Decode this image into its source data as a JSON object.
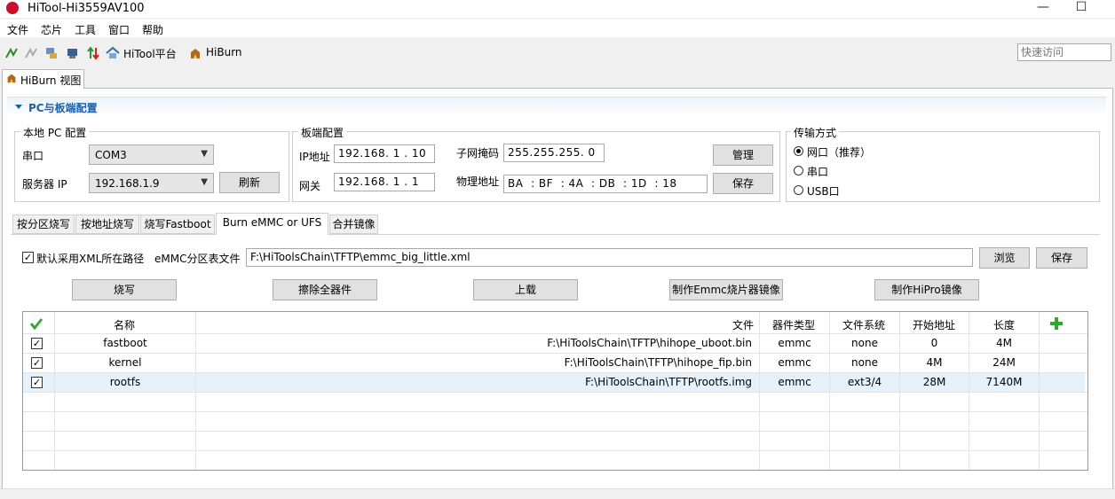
{
  "window": {
    "title": "HiTool-Hi3559AV100",
    "minimize": "—",
    "maximize": "☐"
  },
  "menu": [
    "文件",
    "芯片",
    "工具",
    "窗口",
    "帮助"
  ],
  "toolbar": {
    "hitool_label": "HiTool平台",
    "hiburn_label": "HiBurn",
    "quick_access_placeholder": "快速访问"
  },
  "view_tab": "HiBurn 视图",
  "section": {
    "title": "PC与板端配置"
  },
  "local_pc": {
    "group_title": "本地 PC 配置",
    "port_label": "串口",
    "port_value": "COM3",
    "server_ip_label": "服务器 IP",
    "server_ip_value": "192.168.1.9",
    "refresh_label": "刷新"
  },
  "board": {
    "group_title": "板端配置",
    "ip_label": "IP地址",
    "ip_value": "192.168. 1 . 10",
    "gateway_label": "网关",
    "gateway_value": "192.168. 1 . 1",
    "mask_label": "子网掩码",
    "mask_value": "255.255.255. 0",
    "mac_label": "物理地址",
    "mac_value": "BA  : BF  : 4A  : DB  : 1D  : 18",
    "manage_label": "管理",
    "save_label": "保存"
  },
  "transfer": {
    "group_title": "传输方式",
    "options": [
      "网口（推荐）",
      "串口",
      "USB口"
    ],
    "selected": "网口（推荐）"
  },
  "tabs": [
    "按分区烧写",
    "按地址烧写",
    "烧写Fastboot",
    "Burn eMMC or UFS",
    "合并镜像"
  ],
  "active_tab": "Burn eMMC or UFS",
  "emmc": {
    "default_xml_label": "默认采用XML所在路径",
    "default_xml_checked": true,
    "table_file_label": "eMMC分区表文件",
    "table_file_value": "F:\\HiToolsChain\\TFTP\\emmc_big_little.xml",
    "browse_label": "浏览",
    "save_label": "保存"
  },
  "actions": {
    "burn": "烧写",
    "erase": "擦除全器件",
    "upload": "上载",
    "make_emmc": "制作Emmc烧片器镜像",
    "make_hipro": "制作HiPro镜像"
  },
  "table": {
    "headers": {
      "name": "名称",
      "file": "文件",
      "device": "器件类型",
      "fs": "文件系统",
      "start": "开始地址",
      "length": "长度"
    },
    "rows": [
      {
        "checked": true,
        "name": "fastboot",
        "file": "F:\\HiToolsChain\\TFTP\\hihope_uboot.bin",
        "device": "emmc",
        "fs": "none",
        "start": "0",
        "length": "4M"
      },
      {
        "checked": true,
        "name": "kernel",
        "file": "F:\\HiToolsChain\\TFTP\\hihope_fip.bin",
        "device": "emmc",
        "fs": "none",
        "start": "4M",
        "length": "24M"
      },
      {
        "checked": true,
        "name": "rootfs",
        "file": "F:\\HiToolsChain\\TFTP\\rootfs.img",
        "device": "emmc",
        "fs": "ext3/4",
        "start": "28M",
        "length": "7140M"
      }
    ]
  },
  "colors": {
    "accent": "#1f5fa8",
    "selected_row": "#e5f1fb",
    "plus": "#2ea82e",
    "check": "#3aa63a"
  }
}
